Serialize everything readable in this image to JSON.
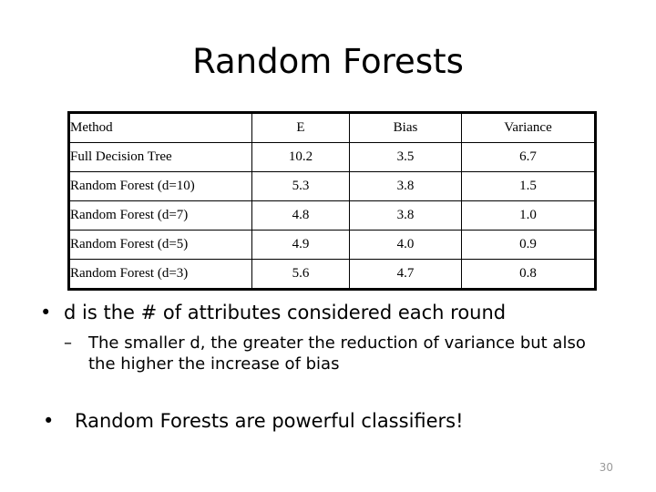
{
  "slide": {
    "title": "Random Forests",
    "page_number": "30",
    "background_color": "#ffffff",
    "text_color": "#000000",
    "page_number_color": "#9a9a9a"
  },
  "table": {
    "border_color": "#000000",
    "headers": {
      "method": "Method",
      "e": "E",
      "bias": "Bias",
      "variance": "Variance"
    },
    "rows": [
      {
        "method": "Full Decision Tree",
        "e": "10.2",
        "bias": "3.5",
        "variance": "6.7"
      },
      {
        "method": "Random Forest (d=10)",
        "e": "5.3",
        "bias": "3.8",
        "variance": "1.5"
      },
      {
        "method": "Random Forest (d=7)",
        "e": "4.8",
        "bias": "3.8",
        "variance": "1.0"
      },
      {
        "method": "Random Forest (d=5)",
        "e": "4.9",
        "bias": "4.0",
        "variance": "0.9"
      },
      {
        "method": "Random Forest (d=3)",
        "e": "5.6",
        "bias": "4.7",
        "variance": "0.8"
      }
    ]
  },
  "body": {
    "bullet1": {
      "marker": "•",
      "text": "d is the # of attributes considered each round"
    },
    "subbullet1": {
      "marker": "–",
      "text": "The smaller d, the greater the reduction of variance but also the higher the increase of bias"
    },
    "bullet2": {
      "marker": "•",
      "text": "Random Forests are powerful classifiers!"
    }
  }
}
